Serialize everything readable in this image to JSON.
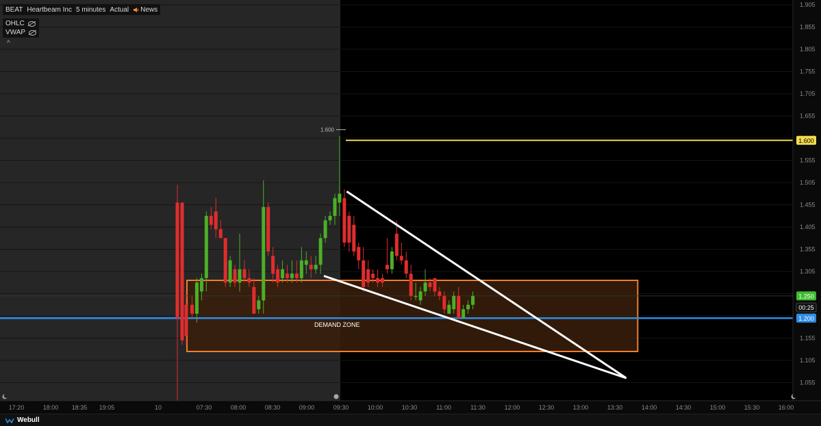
{
  "header": {
    "symbol": "BEAT",
    "company": "Heartbeam Inc",
    "interval": "5 minutes",
    "mode": "Actual",
    "news_label": "News",
    "news_icon": "speaker-icon"
  },
  "indicators": [
    {
      "label": "OHLC",
      "icon": "eye-hidden-icon"
    },
    {
      "label": "VWAP",
      "icon": "eye-hidden-icon"
    }
  ],
  "collapse_glyph": "^",
  "footer": {
    "brand": "Webull",
    "logo_icon": "webull-logo-icon"
  },
  "colors": {
    "background": "#000000",
    "premarket_shade": "#262626",
    "up_candle": "#4caf28",
    "down_candle": "#e02d2d",
    "resistance_line": "#f2dc4c",
    "support_line": "#2e8de6",
    "last_price_badge": "#3dbb2e",
    "demand_zone_stroke": "#f07f2c",
    "demand_zone_fill": "#3a1e0a",
    "trendline": "#ffffff"
  },
  "chart_data": {
    "type": "candlestick",
    "annotations": {
      "demand_zone_label": "DEMAND ZONE",
      "high_marker_label": "1.600",
      "resistance_level": 1.6,
      "support_level": 1.2,
      "last_price": 1.25,
      "demand_zone": {
        "from_time": "07:15",
        "to_time": "13:50",
        "low": 1.125,
        "high": 1.285
      },
      "wedge_upper": [
        [
          "09:35",
          1.485
        ],
        [
          "13:40",
          1.065
        ]
      ],
      "wedge_lower": [
        [
          "09:15",
          1.295
        ],
        [
          "13:40",
          1.065
        ]
      ]
    },
    "price_badges": [
      {
        "label": "1.600",
        "value": 1.6,
        "kind": "resistance"
      },
      {
        "label": "1.250",
        "value": 1.25,
        "kind": "last"
      },
      {
        "label": "00:25",
        "value": 1.224,
        "kind": "countdown"
      },
      {
        "label": "1.200",
        "value": 1.2,
        "kind": "support"
      }
    ],
    "y_ticks": [
      "1.905",
      "1.855",
      "1.805",
      "1.755",
      "1.705",
      "1.655",
      "1.605",
      "1.555",
      "1.505",
      "1.455",
      "1.405",
      "1.355",
      "1.305",
      "1.255",
      "1.205",
      "1.155",
      "1.105",
      "1.055"
    ],
    "x_ticks": [
      "17:20",
      "18:00",
      "18:35",
      "19:05",
      "10",
      "07:30",
      "08:00",
      "08:30",
      "09:00",
      "09:30",
      "10:00",
      "10:30",
      "11:00",
      "11:30",
      "12:00",
      "12:30",
      "13:00",
      "13:30",
      "14:00",
      "14:30",
      "15:00",
      "15:30",
      "16:00"
    ],
    "candles": [
      {
        "o": 1.46,
        "h": 1.5,
        "l": 0.98,
        "c": 1.2
      },
      {
        "o": 1.46,
        "h": 1.46,
        "l": 1.14,
        "c": 1.15
      },
      {
        "o": 1.23,
        "h": 1.26,
        "l": 1.14,
        "c": 1.16
      },
      {
        "o": 1.23,
        "h": 1.25,
        "l": 1.2,
        "c": 1.21
      },
      {
        "o": 1.21,
        "h": 1.29,
        "l": 1.19,
        "c": 1.28
      },
      {
        "o": 1.26,
        "h": 1.3,
        "l": 1.24,
        "c": 1.29
      },
      {
        "o": 1.29,
        "h": 1.44,
        "l": 1.26,
        "c": 1.43
      },
      {
        "o": 1.43,
        "h": 1.45,
        "l": 1.4,
        "c": 1.41
      },
      {
        "o": 1.44,
        "h": 1.47,
        "l": 1.38,
        "c": 1.4
      },
      {
        "o": 1.4,
        "h": 1.42,
        "l": 1.38,
        "c": 1.38
      },
      {
        "o": 1.38,
        "h": 1.38,
        "l": 1.27,
        "c": 1.28
      },
      {
        "o": 1.28,
        "h": 1.34,
        "l": 1.27,
        "c": 1.33
      },
      {
        "o": 1.31,
        "h": 1.32,
        "l": 1.27,
        "c": 1.28
      },
      {
        "o": 1.28,
        "h": 1.39,
        "l": 1.26,
        "c": 1.31
      },
      {
        "o": 1.31,
        "h": 1.33,
        "l": 1.28,
        "c": 1.29
      },
      {
        "o": 1.29,
        "h": 1.31,
        "l": 1.27,
        "c": 1.28
      },
      {
        "o": 1.27,
        "h": 1.29,
        "l": 1.21,
        "c": 1.21
      },
      {
        "o": 1.22,
        "h": 1.25,
        "l": 1.21,
        "c": 1.24
      },
      {
        "o": 1.24,
        "h": 1.51,
        "l": 1.21,
        "c": 1.45
      },
      {
        "o": 1.45,
        "h": 1.46,
        "l": 1.34,
        "c": 1.35
      },
      {
        "o": 1.34,
        "h": 1.36,
        "l": 1.28,
        "c": 1.3
      },
      {
        "o": 1.31,
        "h": 1.32,
        "l": 1.27,
        "c": 1.28
      },
      {
        "o": 1.29,
        "h": 1.33,
        "l": 1.28,
        "c": 1.31
      },
      {
        "o": 1.3,
        "h": 1.32,
        "l": 1.28,
        "c": 1.29
      },
      {
        "o": 1.29,
        "h": 1.33,
        "l": 1.28,
        "c": 1.3
      },
      {
        "o": 1.3,
        "h": 1.33,
        "l": 1.28,
        "c": 1.29
      },
      {
        "o": 1.29,
        "h": 1.36,
        "l": 1.28,
        "c": 1.33
      },
      {
        "o": 1.32,
        "h": 1.35,
        "l": 1.3,
        "c": 1.33
      },
      {
        "o": 1.32,
        "h": 1.34,
        "l": 1.29,
        "c": 1.31
      },
      {
        "o": 1.31,
        "h": 1.34,
        "l": 1.3,
        "c": 1.32
      },
      {
        "o": 1.32,
        "h": 1.39,
        "l": 1.3,
        "c": 1.38
      },
      {
        "o": 1.38,
        "h": 1.43,
        "l": 1.37,
        "c": 1.42
      },
      {
        "o": 1.42,
        "h": 1.44,
        "l": 1.41,
        "c": 1.43
      },
      {
        "o": 1.43,
        "h": 1.48,
        "l": 1.41,
        "c": 1.47
      },
      {
        "o": 1.46,
        "h": 1.61,
        "l": 1.43,
        "c": 1.48
      },
      {
        "o": 1.47,
        "h": 1.49,
        "l": 1.36,
        "c": 1.37
      },
      {
        "o": 1.43,
        "h": 1.44,
        "l": 1.35,
        "c": 1.37
      },
      {
        "o": 1.41,
        "h": 1.43,
        "l": 1.34,
        "c": 1.35
      },
      {
        "o": 1.36,
        "h": 1.37,
        "l": 1.31,
        "c": 1.33
      },
      {
        "o": 1.33,
        "h": 1.36,
        "l": 1.26,
        "c": 1.27
      },
      {
        "o": 1.31,
        "h": 1.33,
        "l": 1.27,
        "c": 1.28
      },
      {
        "o": 1.3,
        "h": 1.31,
        "l": 1.28,
        "c": 1.29
      },
      {
        "o": 1.29,
        "h": 1.31,
        "l": 1.27,
        "c": 1.28
      },
      {
        "o": 1.29,
        "h": 1.3,
        "l": 1.27,
        "c": 1.28
      },
      {
        "o": 1.32,
        "h": 1.38,
        "l": 1.3,
        "c": 1.31
      },
      {
        "o": 1.31,
        "h": 1.36,
        "l": 1.3,
        "c": 1.35
      },
      {
        "o": 1.39,
        "h": 1.42,
        "l": 1.33,
        "c": 1.34
      },
      {
        "o": 1.34,
        "h": 1.37,
        "l": 1.32,
        "c": 1.33
      },
      {
        "o": 1.33,
        "h": 1.35,
        "l": 1.29,
        "c": 1.3
      },
      {
        "o": 1.3,
        "h": 1.32,
        "l": 1.24,
        "c": 1.25
      },
      {
        "o": 1.25,
        "h": 1.28,
        "l": 1.24,
        "c": 1.25
      },
      {
        "o": 1.24,
        "h": 1.27,
        "l": 1.23,
        "c": 1.26
      },
      {
        "o": 1.26,
        "h": 1.31,
        "l": 1.25,
        "c": 1.28
      },
      {
        "o": 1.28,
        "h": 1.29,
        "l": 1.26,
        "c": 1.27
      },
      {
        "o": 1.29,
        "h": 1.29,
        "l": 1.25,
        "c": 1.26
      },
      {
        "o": 1.26,
        "h": 1.27,
        "l": 1.24,
        "c": 1.25
      },
      {
        "o": 1.25,
        "h": 1.26,
        "l": 1.21,
        "c": 1.22
      },
      {
        "o": 1.21,
        "h": 1.24,
        "l": 1.21,
        "c": 1.23
      },
      {
        "o": 1.22,
        "h": 1.26,
        "l": 1.21,
        "c": 1.25
      },
      {
        "o": 1.25,
        "h": 1.27,
        "l": 1.2,
        "c": 1.2
      },
      {
        "o": 1.2,
        "h": 1.23,
        "l": 1.2,
        "c": 1.22
      },
      {
        "o": 1.22,
        "h": 1.24,
        "l": 1.21,
        "c": 1.23
      },
      {
        "o": 1.23,
        "h": 1.26,
        "l": 1.22,
        "c": 1.25
      }
    ]
  }
}
